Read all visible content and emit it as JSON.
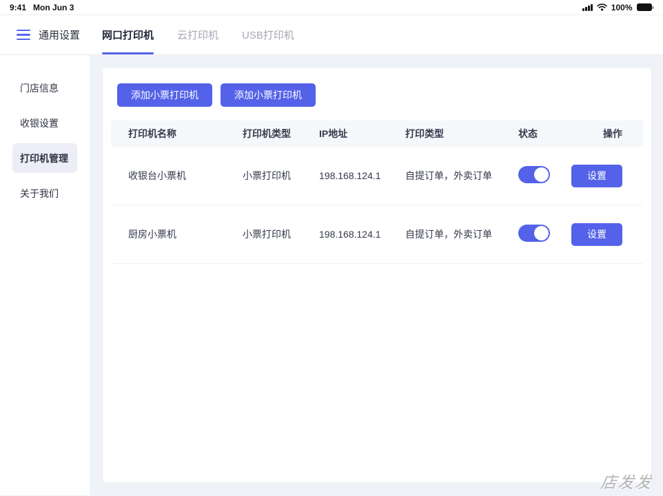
{
  "status_bar": {
    "time": "9:41",
    "date": "Mon Jun 3",
    "battery_percent": "100%"
  },
  "header": {
    "title": "通用设置",
    "tabs": [
      {
        "label": "网口打印机",
        "active": true
      },
      {
        "label": "云打印机",
        "active": false
      },
      {
        "label": "USB打印机",
        "active": false
      }
    ]
  },
  "sidebar": {
    "items": [
      {
        "label": "门店信息",
        "selected": false
      },
      {
        "label": "收银设置",
        "selected": false
      },
      {
        "label": "打印机管理",
        "selected": true
      },
      {
        "label": "关于我们",
        "selected": false
      }
    ]
  },
  "main": {
    "add_buttons": [
      {
        "label": "添加小票打印机"
      },
      {
        "label": "添加小票打印机"
      }
    ],
    "table": {
      "headers": [
        "打印机名称",
        "打印机类型",
        "IP地址",
        "打印类型",
        "状态",
        "操作"
      ],
      "rows": [
        {
          "name": "收银台小票机",
          "type": "小票打印机",
          "ip": "198.168.124.1",
          "print_type": "自提订单，外卖订单",
          "status_on": true,
          "action_label": "设置"
        },
        {
          "name": "厨房小票机",
          "type": "小票打印机",
          "ip": "198.168.124.1",
          "print_type": "自提订单，外卖订单",
          "status_on": true,
          "action_label": "设置"
        }
      ]
    }
  },
  "watermark": "店发发",
  "colors": {
    "accent": "#5362E8",
    "content_bg": "#EFF2F7",
    "table_header_bg": "#F5F7FA",
    "selected_item_bg": "#ECEDF6",
    "inactive_tab_text": "#A3A7B3",
    "dark_text": "#2E3342"
  }
}
